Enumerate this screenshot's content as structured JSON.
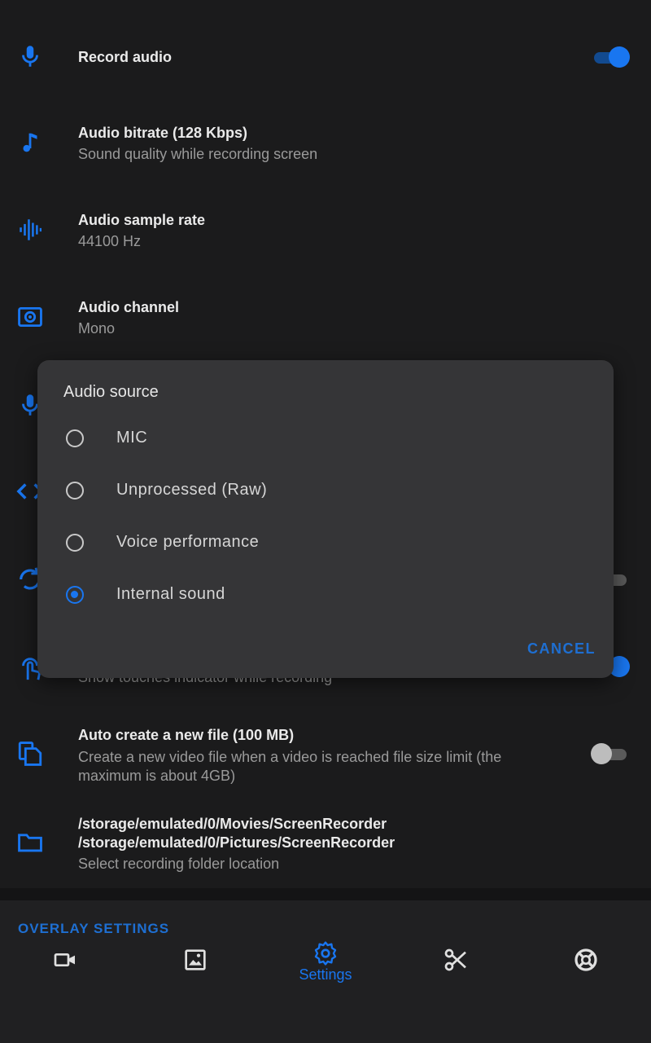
{
  "settings": [
    {
      "icon": "microphone-icon",
      "title": "Record audio",
      "subtitle": "",
      "toggle": "on"
    },
    {
      "icon": "music-note-icon",
      "title": "Audio bitrate (128 Kbps)",
      "subtitle": "Sound quality while recording screen"
    },
    {
      "icon": "waveform-icon",
      "title": "Audio sample rate",
      "subtitle": "44100 Hz"
    },
    {
      "icon": "speaker-icon",
      "title": "Audio channel",
      "subtitle": "Mono"
    },
    {
      "icon": "microphone-icon",
      "title": "",
      "subtitle": ""
    },
    {
      "icon": "code-icon",
      "title": "",
      "subtitle": ""
    },
    {
      "icon": "rotate-icon",
      "title": "",
      "subtitle": "",
      "toggle": "off"
    },
    {
      "icon": "touch-icon",
      "title": "",
      "subtitle": "Show touches indicator while recording",
      "toggle": "on"
    },
    {
      "icon": "copy-file-icon",
      "title": "Auto create a new file (100 MB)",
      "subtitle": "Create a new video file when a video is reached file size limit (the maximum is about 4GB)",
      "toggle": "off"
    },
    {
      "icon": "folder-icon",
      "title": "/storage/emulated/0/Movies/ScreenRecorder\n/storage/emulated/0/Pictures/ScreenRecorder",
      "subtitle": "Select recording folder location"
    }
  ],
  "section_header": "OVERLAY SETTINGS",
  "dialog": {
    "title": "Audio source",
    "options": [
      {
        "label": "MIC",
        "checked": false
      },
      {
        "label": "Unprocessed (Raw)",
        "checked": false
      },
      {
        "label": "Voice performance",
        "checked": false
      },
      {
        "label": "Internal sound",
        "checked": true
      }
    ],
    "cancel_label": "CANCEL"
  },
  "bottom_nav": [
    {
      "icon": "video-camera-icon",
      "label": ""
    },
    {
      "icon": "image-icon",
      "label": ""
    },
    {
      "icon": "gear-icon",
      "label": "Settings",
      "active": true
    },
    {
      "icon": "scissors-icon",
      "label": ""
    },
    {
      "icon": "lifebuoy-icon",
      "label": ""
    }
  ],
  "colors": {
    "accent": "#1976f0",
    "background": "#1b1b1c",
    "dialog": "#353537"
  }
}
